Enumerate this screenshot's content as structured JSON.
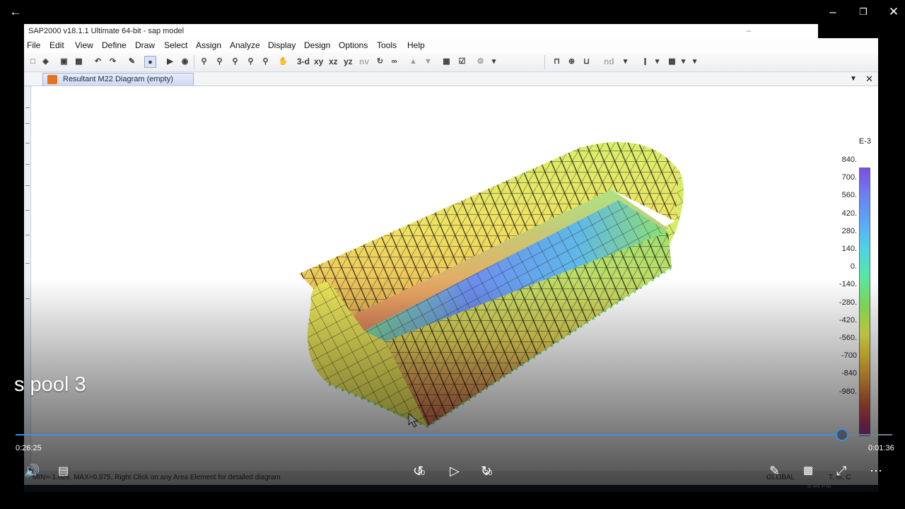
{
  "player": {
    "video_title": "s pool 3",
    "elapsed": "0:26:25",
    "remaining": "0:01:36",
    "progress": 0.943,
    "skip_back_seconds": "10",
    "skip_forward_seconds": "30",
    "accent": "#3a8ee6"
  },
  "sap": {
    "window_title": "SAP2000 v18.1.1 Ultimate 64-bit - sap model",
    "menu": [
      "File",
      "Edit",
      "View",
      "Define",
      "Draw",
      "Select",
      "Assign",
      "Analyze",
      "Display",
      "Design",
      "Options",
      "Tools",
      "Help"
    ],
    "toolbar_view_labels": [
      "3-d",
      "xy",
      "xz",
      "yz",
      "nv"
    ],
    "toolbar_nd_label": "nd",
    "tab_title": "Resultant M22 Diagram   (empty)",
    "status_text": "MIN=-1.026, MAX=0.975, Right Click on any Area Element for detailed diagram",
    "status_right": [
      "GLOBAL",
      "T, m, C"
    ],
    "clock": "8:44 PM",
    "legend": {
      "exponent": "E-3",
      "values": [
        "840.",
        "700.",
        "560.",
        "420.",
        "280.",
        "140.",
        "0.",
        "-140.",
        "-280.",
        "-420.",
        "-560.",
        "-700",
        "-840",
        "-980."
      ]
    }
  }
}
